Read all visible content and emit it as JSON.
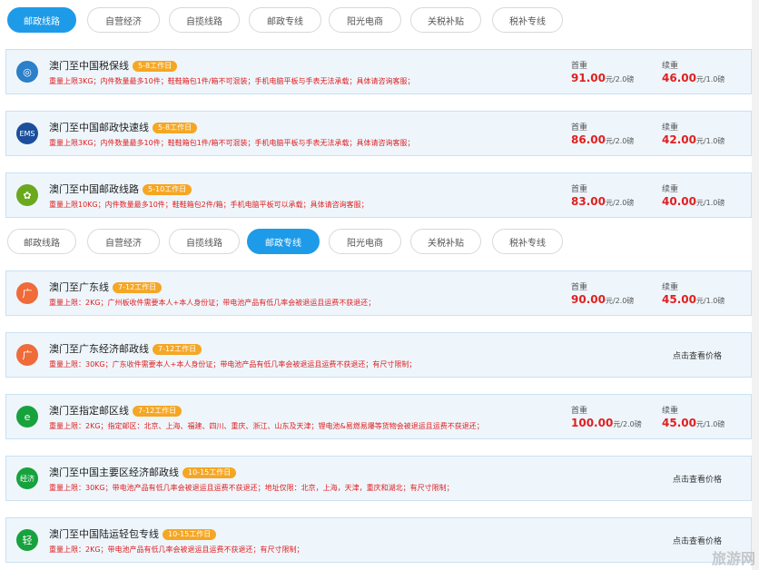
{
  "tabs": [
    "邮政线路",
    "自营经济",
    "自揽线路",
    "邮政专线",
    "阳光电商",
    "关税补贴",
    "税补专线"
  ],
  "first_price_label": "首重",
  "cont_price_label": "续重",
  "check_price_label": "点击查看价格",
  "group1": [
    {
      "name": "澳门至中国税保线",
      "badge": "5-8工作日",
      "note": "重量上限3KG；内件数量最多10件；鞋鞋箱包1件/箱不可混装；手机电脑平板与手表无法承载；具体请咨询客服；",
      "first": "91.00",
      "first_unit": "元/2.0磅",
      "cont": "46.00",
      "cont_unit": "元/1.0磅",
      "icon": "globe-icon",
      "icon_text": "◎",
      "color": "#2c7fc9"
    },
    {
      "name": "澳门至中国邮政快速线",
      "badge": "5-8工作日",
      "note": "重量上限3KG；内件数量最多10件；鞋鞋箱包1件/箱不可混装；手机电脑平板与手表无法承载；具体请咨询客服；",
      "first": "86.00",
      "first_unit": "元/2.0磅",
      "cont": "42.00",
      "cont_unit": "元/1.0磅",
      "icon": "ems-icon",
      "icon_text": "EMS",
      "color": "#1b4f9c"
    },
    {
      "name": "澳门至中国邮政线路",
      "badge": "5-10工作日",
      "note": "重量上限10KG；内件数量最多10件；鞋鞋箱包2件/箱；手机电脑平板可以承载；具体请咨询客服；",
      "first": "83.00",
      "first_unit": "元/2.0磅",
      "cont": "40.00",
      "cont_unit": "元/1.0磅",
      "icon": "post-icon",
      "icon_text": "✿",
      "color": "#6aa81e"
    }
  ],
  "group2": [
    {
      "name": "澳门至广东线",
      "badge": "7-12工作日",
      "note": "重量上限：2KG；广州板收件需要本人+本人身份证；带电池产品有低几率会被退运且运费不获退还；",
      "first": "90.00",
      "first_unit": "元/2.0磅",
      "cont": "45.00",
      "cont_unit": "元/1.0磅",
      "icon_text": "广",
      "color": "#ef6b3a"
    },
    {
      "name": "澳门至广东经济邮政线",
      "badge": "7-12工作日",
      "note": "重量上限：30KG；广东收件需要本人+本人身份证；带电池产品有低几率会被退运且运费不获退还；有尺寸限制；",
      "icon_text": "广",
      "color": "#ef6b3a"
    },
    {
      "name": "澳门至指定邮区线",
      "badge": "7-12工作日",
      "note": "重量上限：2KG；指定邮区：北京、上海、福建、四川、重庆、浙江、山东及天津；锂电池&易燃易爆等货物会被退运且运费不获退还；",
      "first": "100.00",
      "first_unit": "元/2.0磅",
      "cont": "45.00",
      "cont_unit": "元/1.0磅",
      "icon_text": "e",
      "color": "#17a23e"
    },
    {
      "name": "澳门至中国主要区经济邮政线",
      "badge": "10-15工作日",
      "note": "重量上限：30KG；带电池产品有低几率会被退运且运费不获退还；地址仅限：北京，上海，天津，重庆和湖北；有尺寸限制；",
      "icon_text": "经济",
      "color": "#17a23e"
    },
    {
      "name": "澳门至中国陆运轻包专线",
      "badge": "10-15工作日",
      "note": "重量上限：2KG；带电池产品有低几率会被退运且运费不获退还；有尺寸限制；",
      "icon_text": "轻",
      "color": "#17a23e"
    }
  ],
  "watermark": "旅游网"
}
